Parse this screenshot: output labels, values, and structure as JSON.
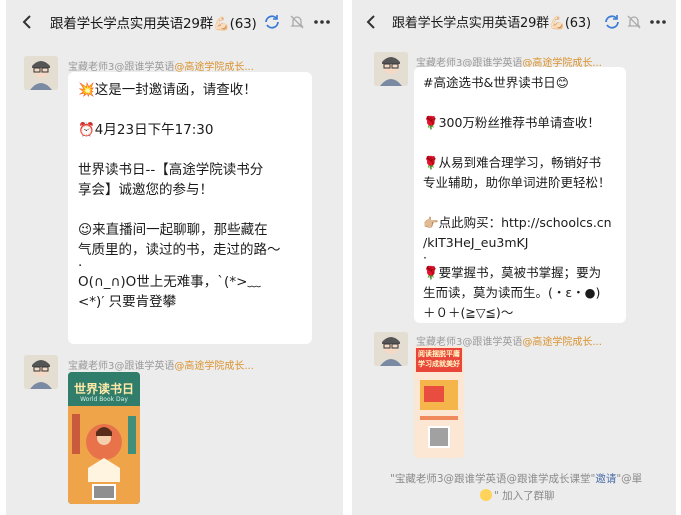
{
  "left": {
    "title": "跟着学长学点实用英语29群💪🏻(63)",
    "sender1": {
      "name": "宝藏老师3@跟谁学英语",
      "org": "@高途学院成长..."
    },
    "message": [
      "💥这是一封邀请函，请查收！",
      "",
      "⏰4月23日下午17:30",
      "",
      "世界读书日--【高途学院读书分",
      "享会】诚邀您的参与！",
      "",
      "😉来直播间一起聊聊，那些藏在",
      "气质里的，读过的书，走过的路～",
      "·",
      "O(∩_∩)O世上无难事，`(*>﹏",
      "<*)′ 只要肯登攀"
    ],
    "sender2": {
      "name": "宝藏老师3@跟谁学英语",
      "org": "@高途学院成长..."
    },
    "poster": {
      "title": "世界读书日",
      "subtitle": "World Book Day"
    }
  },
  "right": {
    "title": "跟着学长学点实用英语29群💪🏻(63)",
    "sender1": {
      "name": "宝藏老师3@跟谁学英语",
      "org": "@高途学院成长..."
    },
    "message": [
      "#高途选书&世界读书日😊",
      "",
      "🌹300万粉丝推荐书单请查收！",
      "",
      "🌹从易到难合理学习，畅销好书",
      "专业辅助，助你单词进阶更轻松！",
      "",
      "👉🏼点此购买：http://schoolcs.cn",
      "/kIT3HeJ_eu3mKJ",
      "·",
      "🌹要掌握书，莫被书掌握；要为",
      "生而读，莫为读而生。(・ε・●)",
      "＋０＋(≧▽≦)～"
    ],
    "sender2": {
      "name": "宝藏老师3@跟谁学英语",
      "org": "@高途学院成长..."
    },
    "poster": {
      "title1": "阅读摆脱平庸",
      "title2": "学习成就美好"
    },
    "notice": {
      "line1_a": "\"宝藏老师3@跟谁学英语@跟谁学成长课堂\"",
      "line1_b": "邀请",
      "line1_c": "\"@單",
      "line2": "\" 加入了群聊"
    }
  },
  "colors": {
    "chat_bg": "#ececec",
    "bubble": "#ffffff",
    "org_tag": "#d9922e"
  }
}
